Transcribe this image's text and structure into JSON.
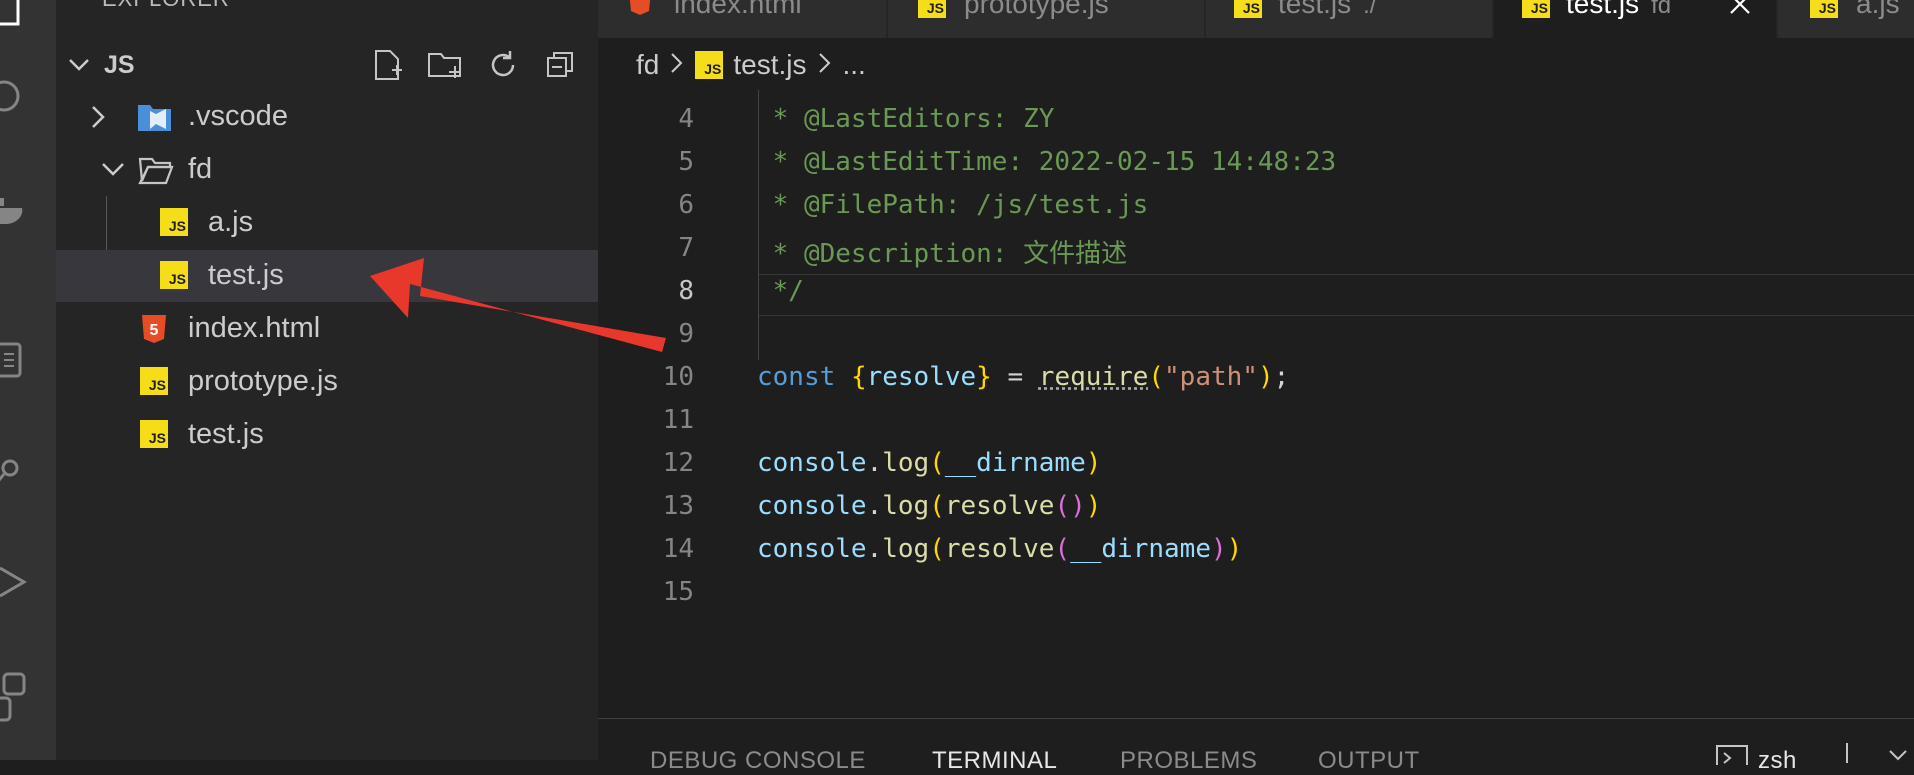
{
  "sidebar": {
    "title": "EXPLORER",
    "folder_name": "JS",
    "actions": [
      "new-file-icon",
      "new-folder-icon",
      "refresh-icon",
      "collapse-all-icon"
    ],
    "items": [
      {
        "label": ".vscode",
        "icon": "vscode-folder-icon",
        "kind": "folder-collapsed"
      },
      {
        "label": "fd",
        "icon": "folder-open-icon",
        "kind": "folder-expanded"
      },
      {
        "label": "a.js",
        "icon": "js-file-icon",
        "kind": "file"
      },
      {
        "label": "test.js",
        "icon": "js-file-icon",
        "kind": "file",
        "selected": true
      },
      {
        "label": "index.html",
        "icon": "html5-file-icon",
        "kind": "file"
      },
      {
        "label": "prototype.js",
        "icon": "js-file-icon",
        "kind": "file"
      },
      {
        "label": "test.js",
        "icon": "js-file-icon",
        "kind": "file"
      }
    ]
  },
  "tabs": [
    {
      "label": "index.html",
      "icon": "html5-file-icon"
    },
    {
      "label": "prototype.js",
      "icon": "js-file-icon"
    },
    {
      "label": "test.js",
      "description": "./",
      "icon": "js-file-icon"
    },
    {
      "label": "test.js",
      "description": "fd",
      "icon": "js-file-icon",
      "active": true
    },
    {
      "label": "a.js",
      "icon": "js-file-icon"
    }
  ],
  "breadcrumb": {
    "folder": "fd",
    "file": "test.js",
    "symbol": "..."
  },
  "editor": {
    "line_numbers": [
      "4",
      "5",
      "6",
      "7",
      "8",
      "9",
      "10",
      "11",
      "12",
      "13",
      "14",
      "15"
    ],
    "current_line": "8",
    "comments": {
      "l4": " * @LastEditors: ZY",
      "l5": " * @LastEditTime: 2022-02-15 14:48:23",
      "l6": " * @FilePath: /js/test.js",
      "l7": " * @Description: 文件描述",
      "l8": " */"
    },
    "tokens": {
      "const": "const",
      "resolve": "resolve",
      "require": "require",
      "path": "\"path\"",
      "console": "console",
      "log": "log",
      "dirname": "__dirname"
    }
  },
  "panel": {
    "tabs": [
      "DEBUG CONSOLE",
      "TERMINAL",
      "PROBLEMS",
      "OUTPUT"
    ],
    "active": "TERMINAL",
    "shell": "zsh"
  },
  "colors": {
    "annotation_arrow": "#e8382b",
    "js_icon": "#f5de19",
    "html_icon": "#e44d26"
  }
}
